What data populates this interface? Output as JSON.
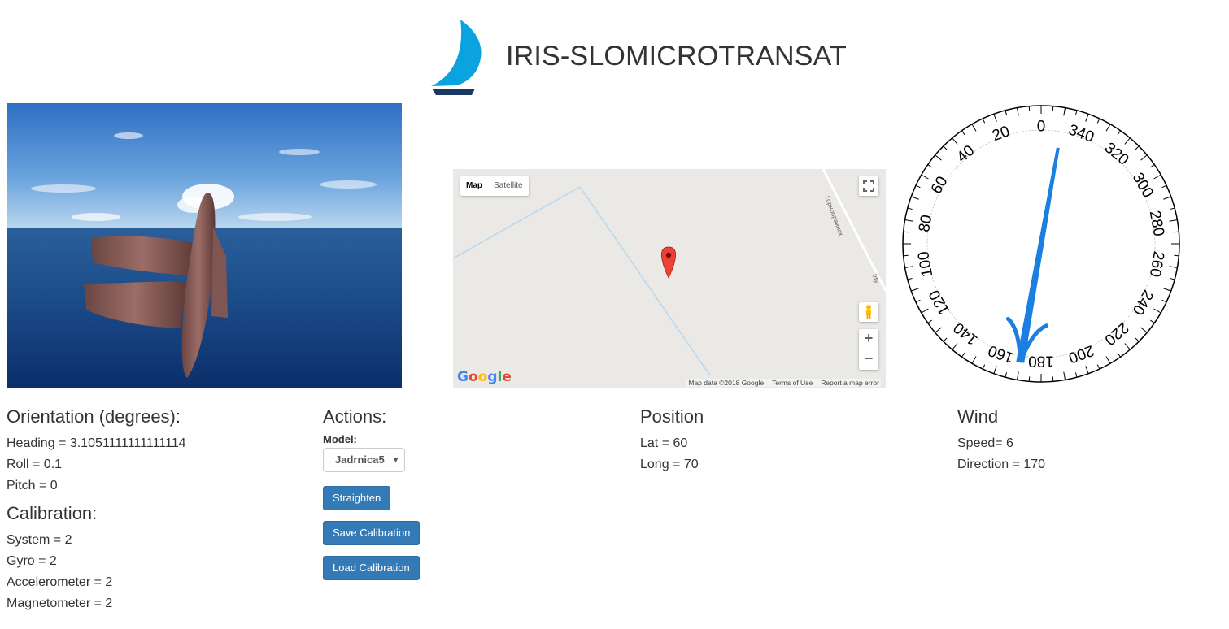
{
  "app": {
    "title": "IRIS-SLOMICROTRANSAT"
  },
  "map": {
    "type_buttons": [
      "Map",
      "Satellite"
    ],
    "active_type": "Map",
    "attribution": "Map data ©2018 Google",
    "terms": "Terms of Use",
    "report": "Report a map error",
    "zoom_in": "+",
    "zoom_out": "−",
    "road_labels": [
      "Горнопраинск",
      "Irty"
    ]
  },
  "compass": {
    "labels": [
      "0",
      "20",
      "40",
      "60",
      "80",
      "100",
      "120",
      "140",
      "160",
      "180",
      "200",
      "220",
      "240",
      "260",
      "280",
      "300",
      "320",
      "340"
    ],
    "arrow_direction_deg": 170,
    "arrow_color": "#1a7fe0"
  },
  "orientation": {
    "title": "Orientation (degrees):",
    "heading": "Heading = 3.1051111111111114",
    "roll": "Roll = 0.1",
    "pitch": "Pitch = 0"
  },
  "calibration": {
    "title": "Calibration:",
    "system": "System = 2",
    "gyro": "Gyro = 2",
    "accelerometer": "Accelerometer = 2",
    "magnetometer": "Magnetometer = 2"
  },
  "actions": {
    "title": "Actions:",
    "model_label": "Model:",
    "model_value": "Jadrnica5",
    "straighten": "Straighten",
    "save_calibration": "Save Calibration",
    "load_calibration": "Load Calibration"
  },
  "position": {
    "title": "Position",
    "lat": "Lat = 60",
    "long": "Long = 70"
  },
  "wind": {
    "title": "Wind",
    "speed": "Speed= 6",
    "direction": "Direction = 170"
  },
  "colors": {
    "primary_button": "#337ab7",
    "sail_blue": "#0aa3df",
    "hull_navy": "#1b3761"
  }
}
